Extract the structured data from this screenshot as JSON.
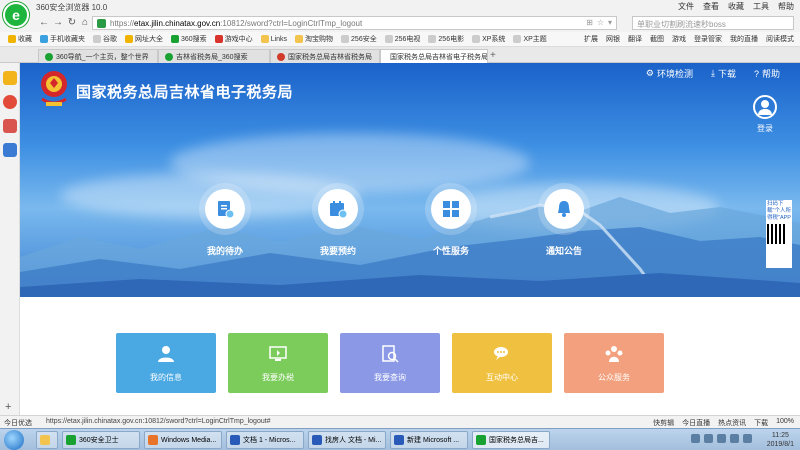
{
  "browser": {
    "title": "360安全浏览器 10.0",
    "menus": [
      "文件",
      "查看",
      "收藏",
      "工具",
      "帮助"
    ],
    "url_prefix": "https://",
    "url_domain": "etax.jilin.chinatax.gov.cn",
    "url_path": ":10812/sword?ctrl=LoginCtrlTmp_logout",
    "search_placeholder": "单职业切割刷流速秒boss",
    "favorites": [
      "收藏",
      "手机收藏夹",
      "谷歌",
      "网址大全",
      "360搜索",
      "游戏中心",
      "Links",
      "淘宝购物",
      "256安全",
      "256电视",
      "256电影",
      "XP系统",
      "XP主题"
    ],
    "right_favs": [
      "扩展",
      "网银",
      "翻译",
      "截图",
      "游戏",
      "登录管家",
      "我的直播",
      "阅读模式"
    ],
    "tabs": [
      {
        "label": "360导航_一个主页，整个世界",
        "color": "#19a232"
      },
      {
        "label": "吉林省税务局_360搜索",
        "color": "#19a232"
      },
      {
        "label": "国家税务总局吉林省税务局",
        "color": "#d23b2a"
      },
      {
        "label": "国家税务总局吉林省电子税务局",
        "color": "#d23b2a"
      }
    ],
    "status_left": "今日优选",
    "status_url": "https://etax.jilin.chinatax.gov.cn:10812/sword?ctrl=LoginCtrlTmp_logout#",
    "status_right": [
      "快剪辑",
      "今日直播",
      "热点资讯",
      "下载",
      "100%"
    ]
  },
  "site": {
    "title": "国家税务总局吉林省电子税务局",
    "links": [
      "环境检测",
      "下载",
      "帮助"
    ],
    "login": "登录",
    "features": [
      {
        "label": "我的待办"
      },
      {
        "label": "我要预约"
      },
      {
        "label": "个性服务"
      },
      {
        "label": "通知公告"
      }
    ],
    "app_ad": "扫码下载\"个人所得税\"APP",
    "services": [
      {
        "label": "我的信息",
        "color": "#4aa8e2"
      },
      {
        "label": "我要办税",
        "color": "#7ccc5c"
      },
      {
        "label": "我要查询",
        "color": "#8a98e6"
      },
      {
        "label": "互动中心",
        "color": "#f0c140"
      },
      {
        "label": "公众服务",
        "color": "#f3a07e"
      }
    ]
  },
  "taskbar": {
    "items": [
      {
        "label": "360安全卫士",
        "color": "#19a232"
      },
      {
        "label": "Windows Media...",
        "color": "#e8742a"
      },
      {
        "label": "文档 1 - Micros...",
        "color": "#2a5ab8"
      },
      {
        "label": "找房人 文档 - Mi...",
        "color": "#2a5ab8"
      },
      {
        "label": "新建 Microsoft ...",
        "color": "#2a5ab8"
      },
      {
        "label": "国家税务总局吉...",
        "color": "#19a232"
      }
    ],
    "time": "11:25",
    "date": "2019/8/1"
  }
}
